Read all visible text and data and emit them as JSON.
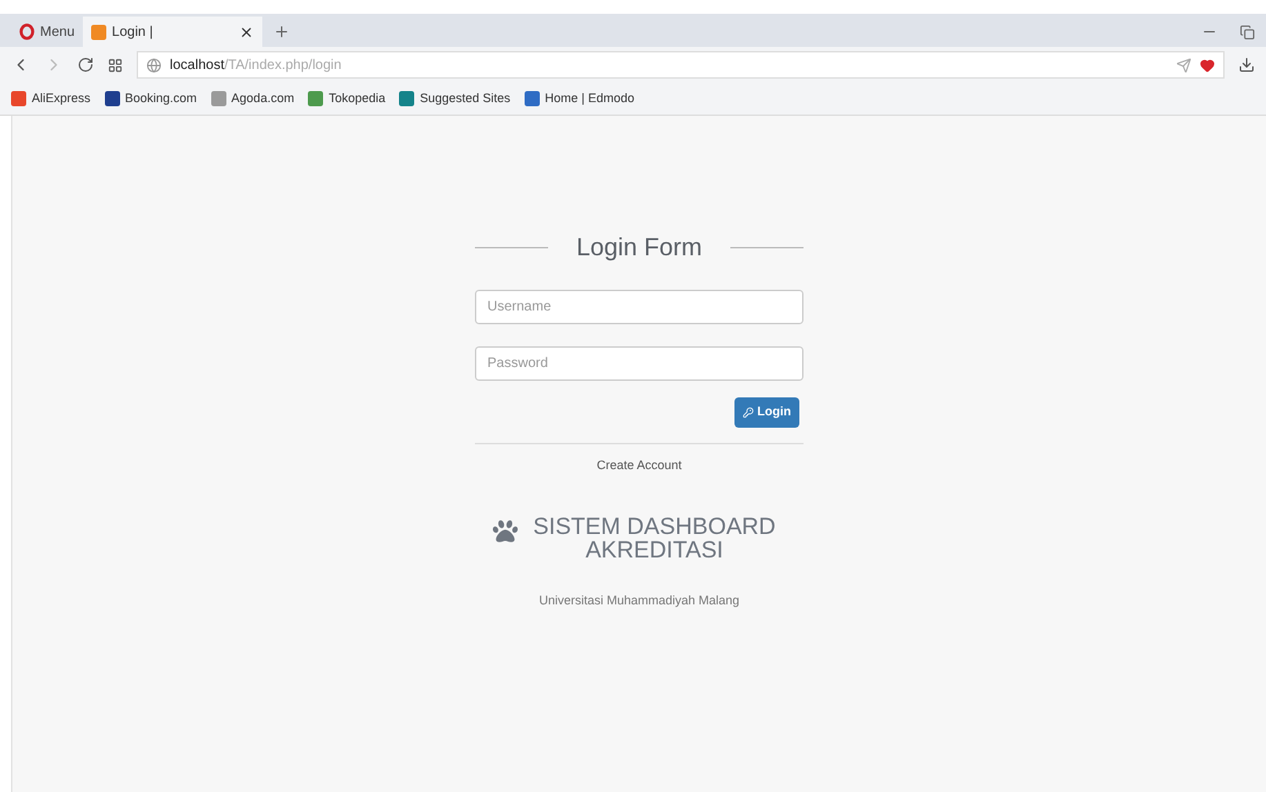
{
  "browser": {
    "menu_label": "Menu",
    "tabs": [
      {
        "title": "Login |",
        "selected": true
      }
    ],
    "address": {
      "host": "localhost",
      "path": "/TA/index.php/login"
    },
    "bookmarks": [
      {
        "label": "AliExpress",
        "color": "#e8472b"
      },
      {
        "label": "Booking.com",
        "color": "#1f3f8f"
      },
      {
        "label": "Agoda.com",
        "color": "#9a9a9a"
      },
      {
        "label": "Tokopedia",
        "color": "#4d9a4d"
      },
      {
        "label": "Suggested Sites",
        "color": "#14838a"
      },
      {
        "label": "Home | Edmodo",
        "color": "#2f6cc4"
      }
    ]
  },
  "login": {
    "title": "Login Form",
    "username": {
      "placeholder": "Username"
    },
    "password": {
      "placeholder": "Password"
    },
    "button": "Login",
    "create_account": "Create Account",
    "brand": "SISTEM DASHBOARD AKREDITASI",
    "university": "Universitasi Muhammadiyah Malang"
  }
}
